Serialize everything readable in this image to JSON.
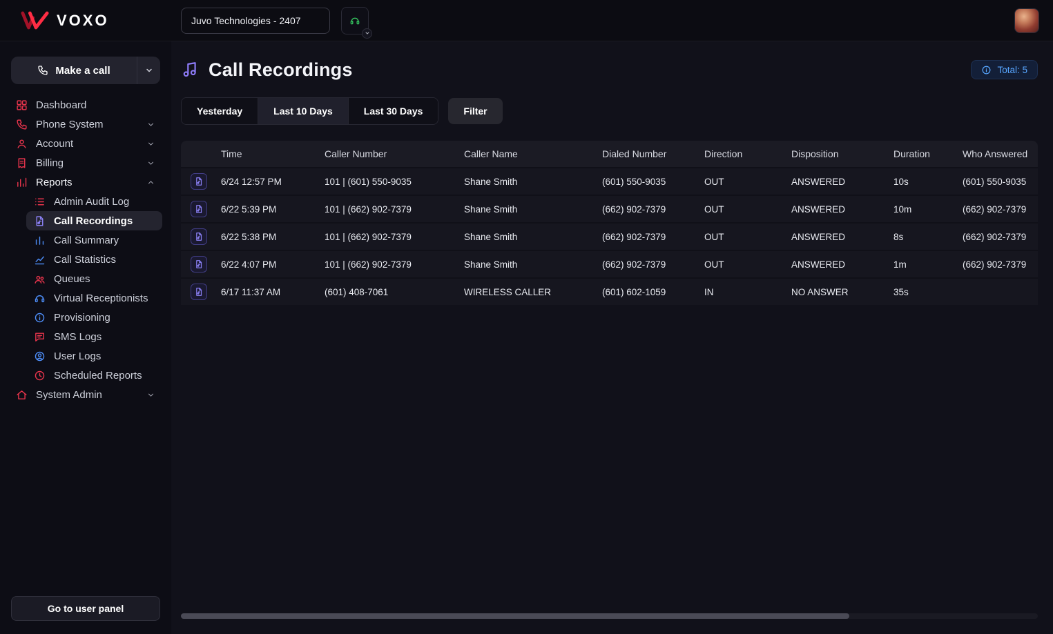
{
  "topbar": {
    "logo_text": "VOXO",
    "org_selector_value": "Juvo Technologies - 2407"
  },
  "sidebar": {
    "make_call_label": "Make a call",
    "go_to_user_panel_label": "Go to user panel",
    "items": [
      {
        "label": "Dashboard",
        "icon": "dashboard-icon",
        "color": "#e8344c"
      },
      {
        "label": "Phone System",
        "icon": "phone-system-icon",
        "color": "#e8344c",
        "chevron": "down"
      },
      {
        "label": "Account",
        "icon": "account-icon",
        "color": "#e8344c",
        "chevron": "down"
      },
      {
        "label": "Billing",
        "icon": "billing-icon",
        "color": "#e8344c",
        "chevron": "down"
      },
      {
        "label": "Reports",
        "icon": "reports-icon",
        "color": "#e8344c",
        "chevron": "up",
        "emphasis": true
      },
      {
        "label": "Admin Audit Log",
        "icon": "audit-log-icon",
        "color": "#e8344c",
        "sub": true
      },
      {
        "label": "Call Recordings",
        "icon": "call-recordings-icon",
        "color": "#8d82f7",
        "sub": true,
        "active": true
      },
      {
        "label": "Call Summary",
        "icon": "call-summary-icon",
        "color": "#4d8df7",
        "sub": true
      },
      {
        "label": "Call Statistics",
        "icon": "call-statistics-icon",
        "color": "#4d8df7",
        "sub": true
      },
      {
        "label": "Queues",
        "icon": "queues-icon",
        "color": "#e8344c",
        "sub": true
      },
      {
        "label": "Virtual Receptionists",
        "icon": "virtual-receptionists-icon",
        "color": "#4d8df7",
        "sub": true
      },
      {
        "label": "Provisioning",
        "icon": "provisioning-icon",
        "color": "#4d8df7",
        "sub": true
      },
      {
        "label": "SMS Logs",
        "icon": "sms-logs-icon",
        "color": "#e8344c",
        "sub": true
      },
      {
        "label": "User Logs",
        "icon": "user-logs-icon",
        "color": "#4d8df7",
        "sub": true
      },
      {
        "label": "Scheduled Reports",
        "icon": "scheduled-reports-icon",
        "color": "#e8344c",
        "sub": true
      },
      {
        "label": "System Admin",
        "icon": "system-admin-icon",
        "color": "#e8344c",
        "chevron": "down"
      }
    ]
  },
  "main": {
    "title": "Call Recordings",
    "total_badge_label": "Total: 5",
    "filter_label": "Filter",
    "tabs": [
      {
        "label": "Yesterday",
        "active": false
      },
      {
        "label": "Last 10 Days",
        "active": true
      },
      {
        "label": "Last 30 Days",
        "active": false
      }
    ],
    "table": {
      "columns": [
        "Time",
        "Caller Number",
        "Caller Name",
        "Dialed Number",
        "Direction",
        "Disposition",
        "Duration",
        "Who Answered"
      ],
      "rows": [
        [
          "6/24 12:57 PM",
          "101 | (601) 550-9035",
          "Shane Smith",
          "(601) 550-9035",
          "OUT",
          "ANSWERED",
          "10s",
          "(601) 550-9035"
        ],
        [
          "6/22 5:39 PM",
          "101 | (662) 902-7379",
          "Shane Smith",
          "(662) 902-7379",
          "OUT",
          "ANSWERED",
          "10m",
          "(662) 902-7379"
        ],
        [
          "6/22 5:38 PM",
          "101 | (662) 902-7379",
          "Shane Smith",
          "(662) 902-7379",
          "OUT",
          "ANSWERED",
          "8s",
          "(662) 902-7379"
        ],
        [
          "6/22 4:07 PM",
          "101 | (662) 902-7379",
          "Shane Smith",
          "(662) 902-7379",
          "OUT",
          "ANSWERED",
          "1m",
          "(662) 902-7379"
        ],
        [
          "6/17 11:37 AM",
          "(601) 408-7061",
          "WIRELESS CALLER",
          "(601) 602-1059",
          "IN",
          "NO ANSWER",
          "35s",
          ""
        ]
      ]
    }
  },
  "colors": {
    "accent_red": "#e8344c",
    "accent_purple": "#8d82f7",
    "accent_blue": "#4d8df7",
    "badge_blue": "#58a6ff",
    "headset_green": "#35c45f"
  }
}
